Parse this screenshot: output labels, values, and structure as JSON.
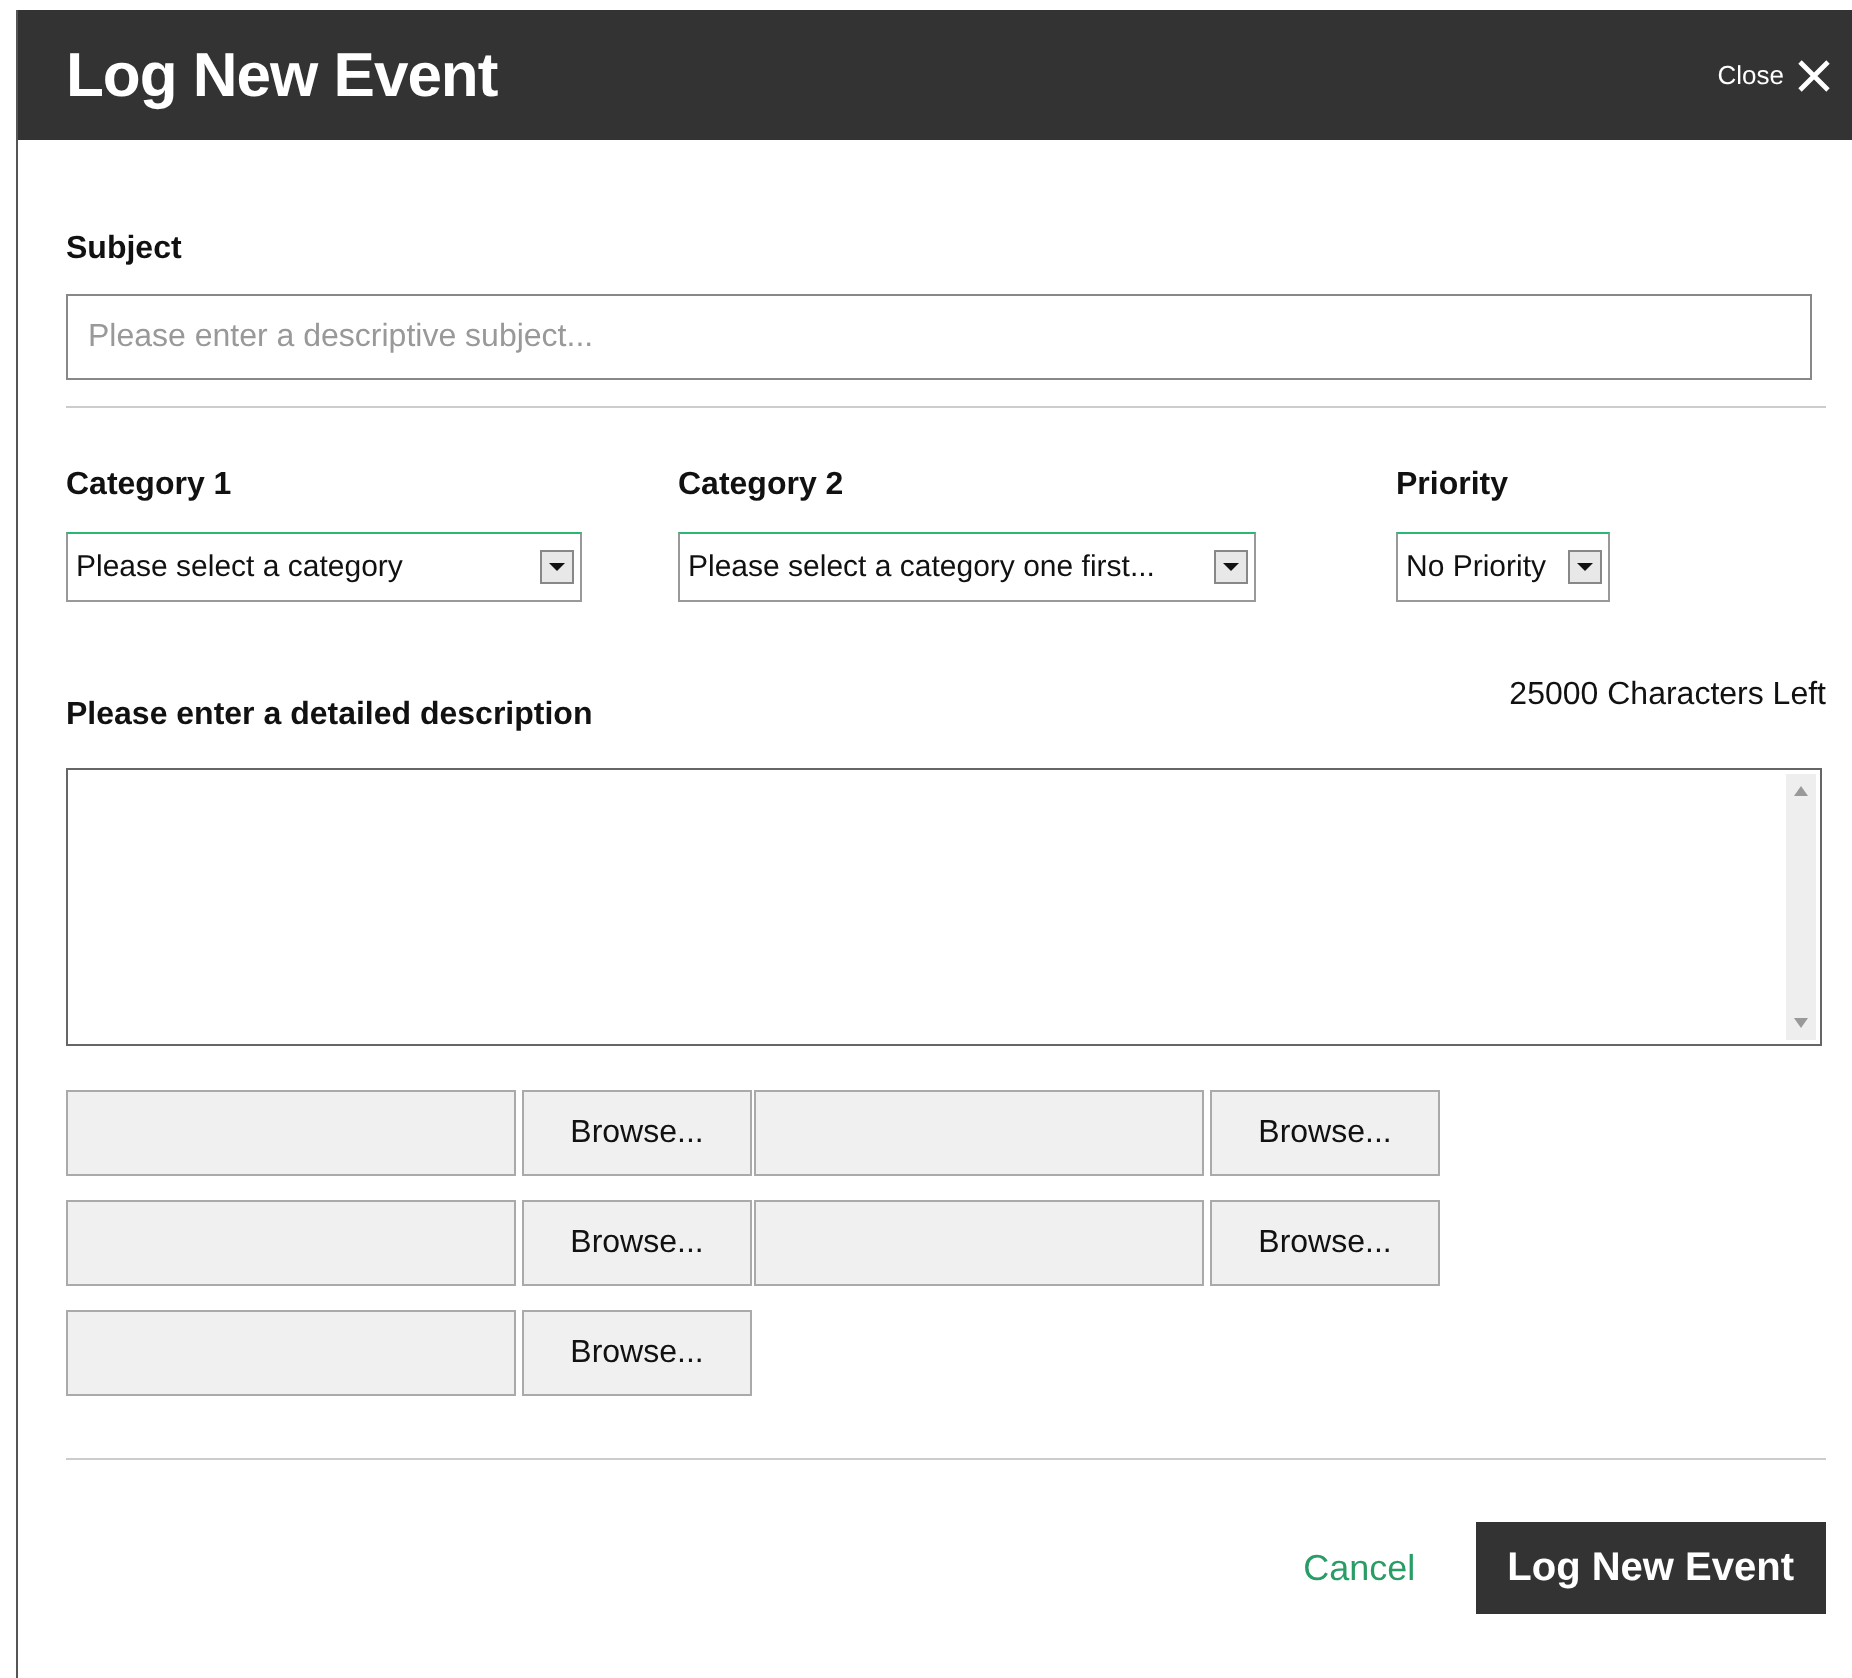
{
  "dialog": {
    "title": "Log New Event",
    "close_label": "Close"
  },
  "subject": {
    "label": "Subject",
    "placeholder": "Please enter a descriptive subject..."
  },
  "selects": [
    {
      "label": "Category 1",
      "value": "Please select a category"
    },
    {
      "label": "Category 2",
      "value": "Please select a category one first..."
    },
    {
      "label": "Priority",
      "value": "No Priority"
    }
  ],
  "description": {
    "label": "Please enter a detailed description",
    "counter": "25000 Characters Left"
  },
  "uploads": [
    {
      "button": "Browse..."
    },
    {
      "button": "Browse..."
    },
    {
      "button": "Browse..."
    },
    {
      "button": "Browse..."
    },
    {
      "button": "Browse..."
    }
  ],
  "actions": {
    "cancel": "Cancel",
    "submit": "Log New Event"
  }
}
